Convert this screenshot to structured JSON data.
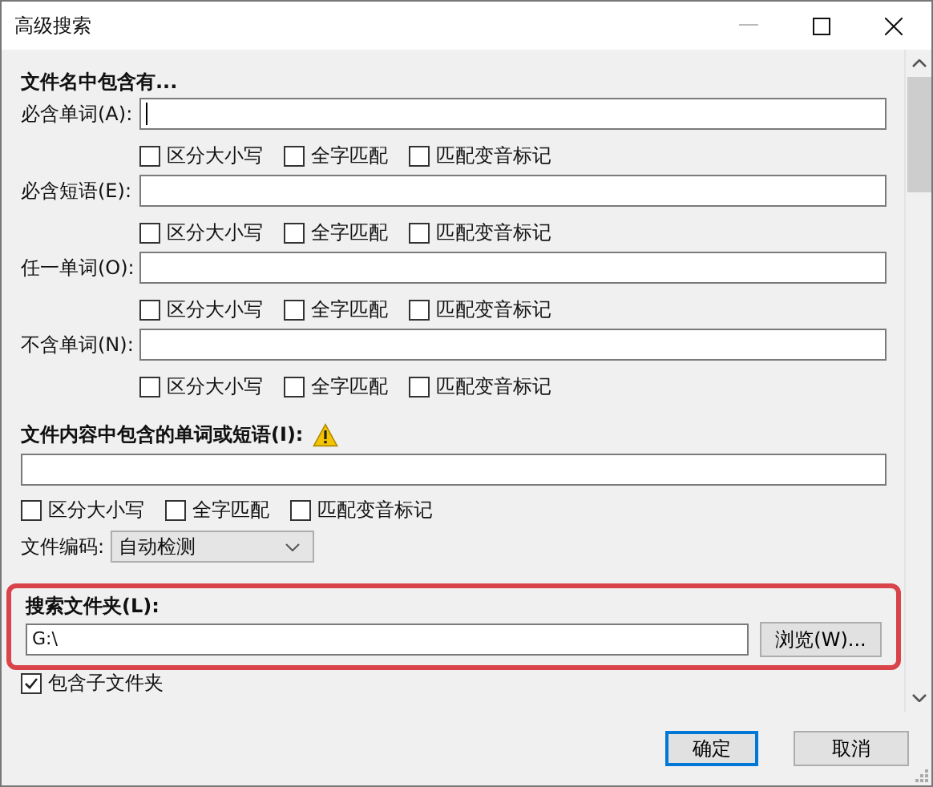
{
  "window": {
    "title": "高级搜索"
  },
  "filename_section": {
    "heading": "文件名中包含有...",
    "fields": [
      {
        "label": "必含单词(A):",
        "focused": true,
        "options": [
          {
            "label": "区分大小写",
            "checked": false
          },
          {
            "label": "全字匹配",
            "checked": false
          },
          {
            "label": "匹配变音标记",
            "checked": false
          }
        ]
      },
      {
        "label": "必含短语(E):",
        "focused": false,
        "options": [
          {
            "label": "区分大小写",
            "checked": false
          },
          {
            "label": "全字匹配",
            "checked": false
          },
          {
            "label": "匹配变音标记",
            "checked": false
          }
        ]
      },
      {
        "label": "任一单词(O):",
        "focused": false,
        "options": [
          {
            "label": "区分大小写",
            "checked": false
          },
          {
            "label": "全字匹配",
            "checked": false
          },
          {
            "label": "匹配变音标记",
            "checked": false
          }
        ]
      },
      {
        "label": "不含单词(N):",
        "focused": false,
        "options": [
          {
            "label": "区分大小写",
            "checked": false
          },
          {
            "label": "全字匹配",
            "checked": false
          },
          {
            "label": "匹配变音标记",
            "checked": false
          }
        ]
      }
    ]
  },
  "content_section": {
    "heading": "文件内容中包含的单词或短语(I):",
    "options": [
      {
        "label": "区分大小写",
        "checked": false
      },
      {
        "label": "全字匹配",
        "checked": false
      },
      {
        "label": "匹配变音标记",
        "checked": false
      }
    ],
    "encoding": {
      "label": "文件编码:",
      "value": "自动检测"
    }
  },
  "folder_section": {
    "heading": "搜索文件夹(L):",
    "value": "G:\\",
    "browse_button": "浏览(W)...",
    "highlighted": true,
    "include_subfolders": {
      "label": "包含子文件夹",
      "checked": true
    }
  },
  "buttons": [
    {
      "label": "确定",
      "default": true
    },
    {
      "label": "取消",
      "default": false
    }
  ]
}
